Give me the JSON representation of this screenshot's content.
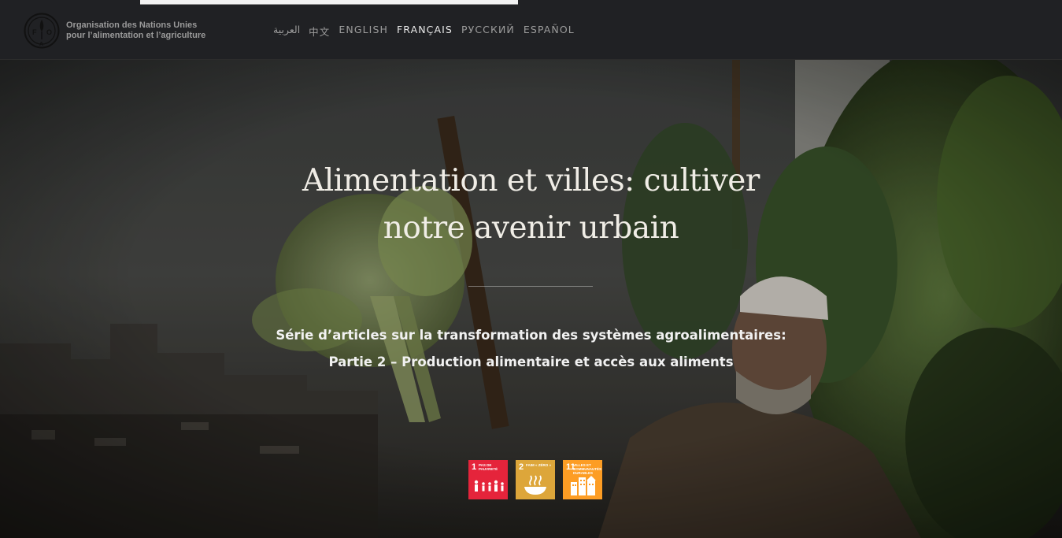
{
  "header": {
    "org_line1": "Organisation des Nations Unies",
    "org_line2": "pour l’alimentation et l’agriculture",
    "logo_letters": "FAO",
    "languages": [
      {
        "label": "العربية",
        "active": false
      },
      {
        "label": "中文",
        "active": false
      },
      {
        "label": "ENGLISH",
        "active": false
      },
      {
        "label": "FRANÇAIS",
        "active": true
      },
      {
        "label": "РУССКИЙ",
        "active": false
      },
      {
        "label": "ESPAÑOL",
        "active": false
      }
    ]
  },
  "hero": {
    "title_line1": "Alimentation et villes: cultiver",
    "title_line2": "notre avenir urbain",
    "subtitle_line1": "Série d’articles sur la transformation des systèmes agroalimentaires:",
    "subtitle_line2": "Partie 2 – Production alimentaire et accès aux aliments"
  },
  "sdgs": [
    {
      "number": "1",
      "label": "PAS DE PAUVRETÉ",
      "color": "#e5243b",
      "icon": "family-icon"
    },
    {
      "number": "2",
      "label": "FAIM « ZÉRO »",
      "color": "#dda63a",
      "icon": "food-bowl-icon"
    },
    {
      "number": "11",
      "label": "VILLES ET COMMUNAUTÉS DURABLES",
      "color": "#fd9d24",
      "icon": "city-buildings-icon"
    }
  ],
  "colors": {
    "header_bg": "#202124",
    "active_language": "#e9e9e9",
    "inactive_language": "#9c9c9c"
  }
}
